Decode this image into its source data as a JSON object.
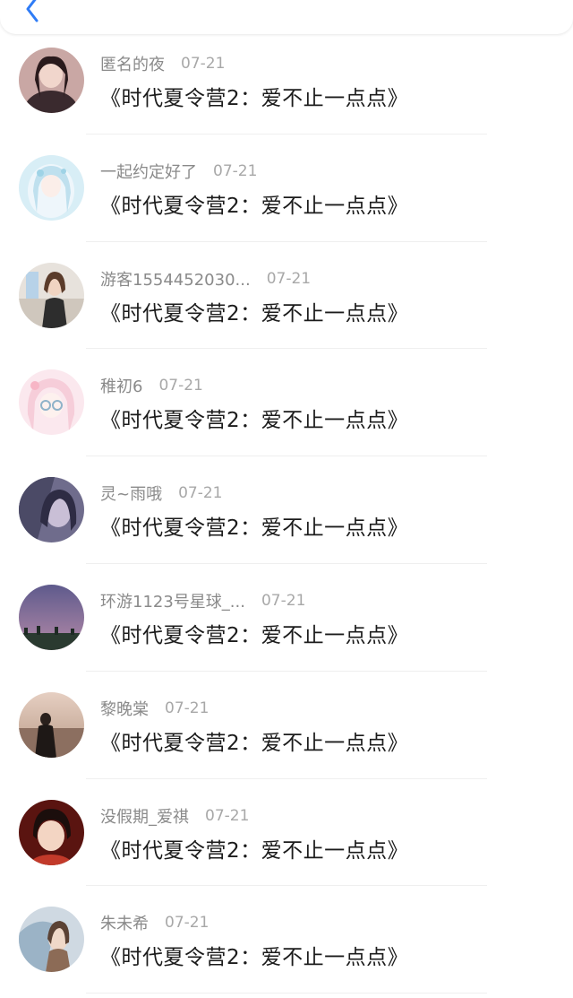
{
  "header": {
    "back_icon": "chevron-left-icon",
    "accent_color": "#2f7cf6"
  },
  "comments": [
    {
      "username": "匿名的夜",
      "date": "07-21",
      "title": "《时代夏令营2：爱不止一点点》"
    },
    {
      "username": "一起约定好了",
      "date": "07-21",
      "title": "《时代夏令营2：爱不止一点点》"
    },
    {
      "username": "游客1554452030...",
      "date": "07-21",
      "title": "《时代夏令营2：爱不止一点点》"
    },
    {
      "username": "稚初6",
      "date": "07-21",
      "title": "《时代夏令营2：爱不止一点点》"
    },
    {
      "username": "灵~雨哦",
      "date": "07-21",
      "title": "《时代夏令营2：爱不止一点点》"
    },
    {
      "username": "环游1123号星球_...",
      "date": "07-21",
      "title": "《时代夏令营2：爱不止一点点》"
    },
    {
      "username": "黎晚棠",
      "date": "07-21",
      "title": "《时代夏令营2：爱不止一点点》"
    },
    {
      "username": "没假期_爱祺",
      "date": "07-21",
      "title": "《时代夏令营2：爱不止一点点》"
    },
    {
      "username": "朱未希",
      "date": "07-21",
      "title": "《时代夏令营2：爱不止一点点》"
    }
  ]
}
